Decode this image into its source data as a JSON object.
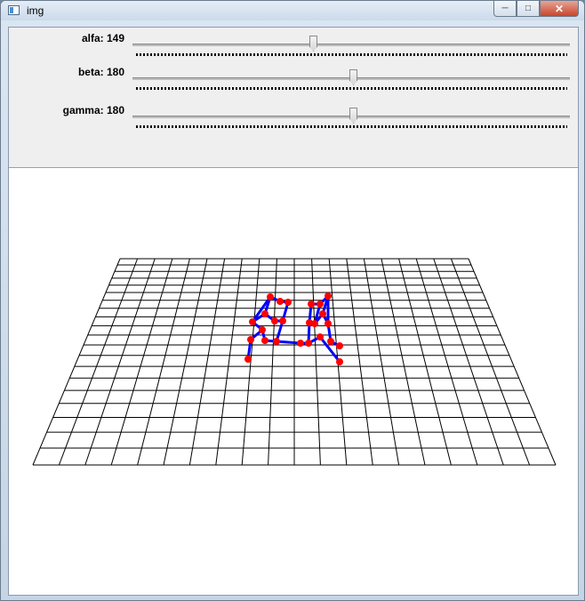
{
  "window": {
    "title": "img",
    "icons": [
      "app-icon",
      "minimize-icon",
      "maximize-icon",
      "close-icon"
    ]
  },
  "trackbars": [
    {
      "id": "alfa",
      "label": "alfa: 149",
      "value": 149,
      "max": 360
    },
    {
      "id": "beta",
      "label": "beta: 180",
      "value": 180,
      "max": 360
    },
    {
      "id": "gamma",
      "label": "gamma: 180",
      "value": 180,
      "max": 360
    }
  ],
  "scene": {
    "grid_cols": 20,
    "grid_rows": 20,
    "grid_color": "#000000",
    "bone_color": "#0000ff",
    "joint_color": "#ff0000"
  }
}
